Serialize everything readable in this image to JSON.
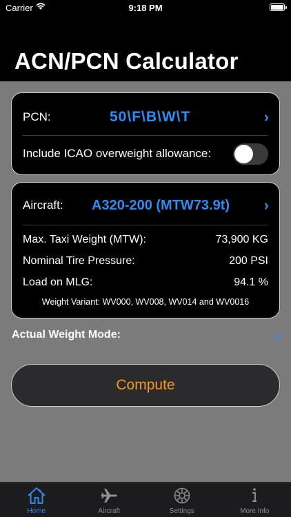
{
  "status_bar": {
    "carrier": "Carrier",
    "time": "9:18 PM"
  },
  "header": {
    "title": "ACN/PCN Calculator"
  },
  "pcn_card": {
    "pcn_label": "PCN:",
    "pcn_value": "50\\F\\B\\W\\T",
    "overweight_label": "Include ICAO overweight allowance:",
    "overweight_enabled": false
  },
  "aircraft_card": {
    "aircraft_label": "Aircraft:",
    "aircraft_value": "A320-200 (MTW73.9t)",
    "specs": [
      {
        "label": "Max. Taxi Weight (MTW):",
        "value": "73,900 KG"
      },
      {
        "label": "Nominal Tire Pressure:",
        "value": "200 PSI"
      },
      {
        "label": "Load on MLG:",
        "value": "94.1 %"
      }
    ],
    "variant": "Weight Variant: WV000, WV008, WV014 and WV0016"
  },
  "actual_weight_mode_label": "Actual Weight Mode:",
  "compute_label": "Compute",
  "tabs": [
    {
      "label": "Home",
      "icon": "home-icon",
      "active": true
    },
    {
      "label": "Aircraft",
      "icon": "airplane-icon",
      "active": false
    },
    {
      "label": "Settings",
      "icon": "gear-icon",
      "active": false
    },
    {
      "label": "More Info",
      "icon": "info-icon",
      "active": false
    }
  ],
  "colors": {
    "accent": "#2f8cf2",
    "compute_text": "#f39a1e",
    "background": "#7b7b7b"
  }
}
